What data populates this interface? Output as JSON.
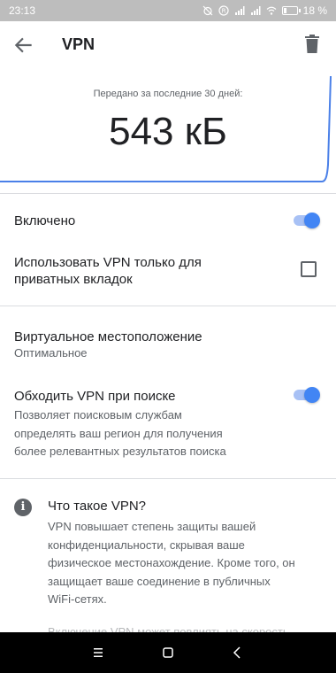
{
  "status_bar": {
    "time": "23:13",
    "battery": "18 %",
    "icons": [
      "alarm-off-icon",
      "sim-icon",
      "signal-icon",
      "signal-icon",
      "wifi-icon",
      "battery-icon"
    ]
  },
  "toolbar": {
    "title": "VPN",
    "back_icon": "arrow-back-icon",
    "delete_icon": "trash-icon"
  },
  "usage": {
    "caption": "Передано за последние 30 дней:",
    "value": "543 кБ"
  },
  "settings": {
    "enabled": {
      "label": "Включено",
      "checked": true
    },
    "private_only": {
      "label_line1": "Использовать VPN только для",
      "label_line2": "приватных вкладок",
      "checked": false
    },
    "location": {
      "label": "Виртуальное местоположение",
      "value": "Оптимальное"
    },
    "bypass_search": {
      "label": "Обходить VPN при поиске",
      "checked": true,
      "desc_line1": "Позволяет поисковым службам",
      "desc_line2": "определять ваш регион для получения",
      "desc_line3": "более релевантных результатов поиска"
    }
  },
  "info": {
    "icon": "info-icon",
    "title": "Что такое VPN?",
    "body_line1": "VPN повышает степень защиты вашей",
    "body_line2": "конфиденциальности, скрывая ваше",
    "body_line3": "физическое местонахождение. Кроме того, он",
    "body_line4": "защищает ваше соединение в публичных",
    "body_line5": "WiFi-сетях.",
    "body_more": "Включение VPN может повлиять на скорость"
  },
  "nav_bar": {
    "icons": [
      "menu-icon",
      "home-icon",
      "back-icon"
    ]
  },
  "colors": {
    "accent": "#4285f4",
    "accent_track": "#a8c1f5",
    "chart_line": "#4a80e8",
    "status_bar_bg": "#bdbdbd",
    "nav_bar_bg": "#000000"
  }
}
